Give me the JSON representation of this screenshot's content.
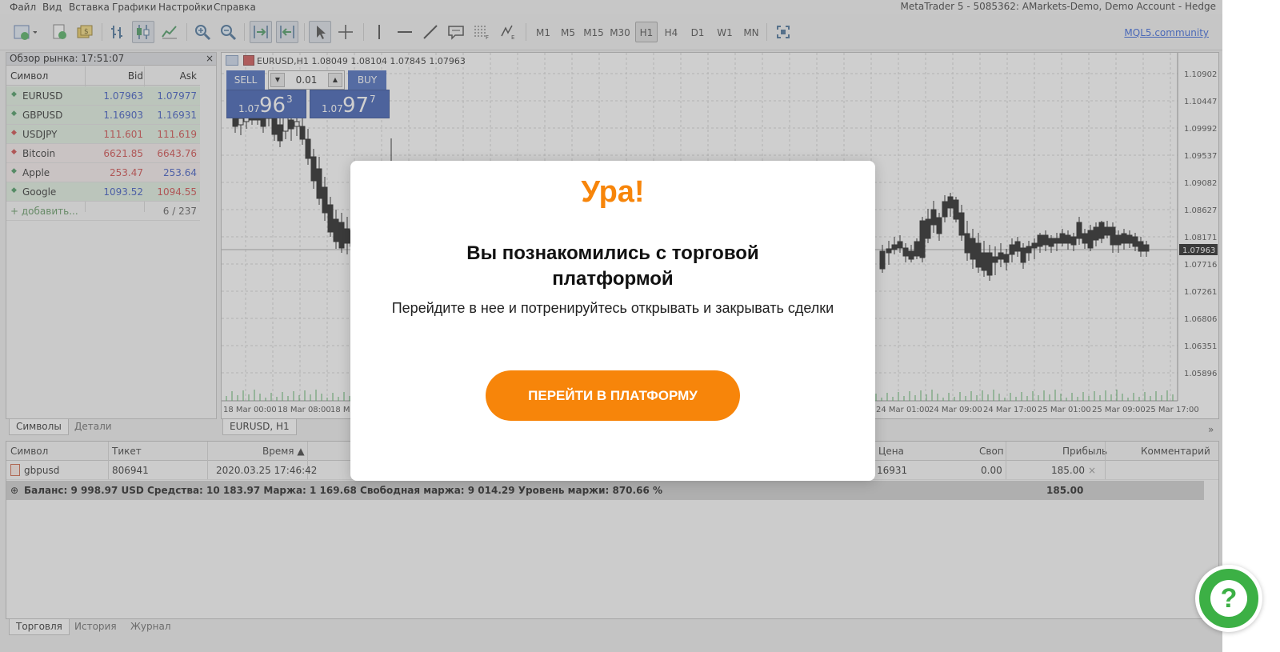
{
  "menu": {
    "items": [
      "Файл",
      "Вид",
      "Вставка",
      "Графики",
      "Настройки",
      "Справка"
    ],
    "window_title": "MetaTrader 5 - 5085362: AMarkets-Demo, Demo Account - Hedge"
  },
  "toolbar": {
    "timeframes": [
      "M1",
      "M5",
      "M15",
      "M30",
      "H1",
      "H4",
      "D1",
      "W1",
      "MN"
    ],
    "active_timeframe": "H1",
    "community_link": "MQL5.community"
  },
  "market_watch": {
    "title": "Обзор рынка: 17:51:07",
    "close_label": "×",
    "columns": {
      "symbol": "Символ",
      "bid": "Bid",
      "ask": "Ask"
    },
    "rows": [
      {
        "symbol": "EURUSD",
        "bid": "1.07963",
        "ask": "1.07977",
        "direction": "up"
      },
      {
        "symbol": "GBPUSD",
        "bid": "1.16903",
        "ask": "1.16931",
        "direction": "up"
      },
      {
        "symbol": "USDJPY",
        "bid": "111.601",
        "ask": "111.619",
        "direction": "down"
      },
      {
        "symbol": "Bitcoin",
        "bid": "6621.85",
        "ask": "6643.76",
        "direction": "down"
      },
      {
        "symbol": "Apple",
        "bid": "253.47",
        "ask": "253.64",
        "direction": "up"
      },
      {
        "symbol": "Google",
        "bid": "1093.52",
        "ask": "1094.55",
        "direction": "up"
      }
    ],
    "add_label": "+ добавить...",
    "count": "6 / 237",
    "tabs": [
      "Символы",
      "Детали"
    ]
  },
  "chart": {
    "info": "EURUSD,H1  1.08049 1.08104 1.07845 1.07963",
    "tab": "EURUSD, H1",
    "price_labels": [
      "1.10902",
      "1.10447",
      "1.09992",
      "1.09537",
      "1.09082",
      "1.08627",
      "1.08171",
      "1.07716",
      "1.07261",
      "1.06806",
      "1.06351",
      "1.05896"
    ],
    "current_price": "1.07963",
    "time_labels": [
      "18 Mar 00:00",
      "18 Mar 08:00",
      "18 Ma",
      "24 Mar 01:00",
      "24 Mar 09:00",
      "24 Mar 17:00",
      "25 Mar 01:00",
      "25 Mar 09:00",
      "25 Mar 17:00"
    ],
    "one_click": {
      "sell_label": "SELL",
      "buy_label": "BUY",
      "lot": "0.01",
      "sell_small": "1.07",
      "sell_big": "96",
      "sell_sup": "3",
      "buy_small": "1.07",
      "buy_big": "97",
      "buy_sup": "7"
    }
  },
  "terminal": {
    "columns": {
      "symbol": "Символ",
      "ticket": "Тикет",
      "time": "Время ▲",
      "price": "Цена",
      "swap": "Своп",
      "profit": "Прибыль",
      "comment": "Комментарий"
    },
    "row": {
      "symbol": "gbpusd",
      "ticket": "806941",
      "time": "2020.03.25 17:46:42",
      "price": "16931",
      "swap": "0.00",
      "profit": "185.00",
      "close": "×"
    },
    "balance_line": "Баланс: 9 998.97 USD  Средства: 10 183.97  Маржа: 1 169.68  Свободная маржа: 9 014.29  Уровень маржи: 870.66 %",
    "balance_profit": "185.00",
    "tabs": [
      "Торговля",
      "История",
      "Журнал"
    ],
    "expand": "»"
  },
  "modal": {
    "title": "Ура!",
    "heading_line1": "Вы познакомились с торговой",
    "heading_line2": "платформой",
    "description": "Перейдите в нее и потренируйтесь открывать и закрывать сделки",
    "cta": "ПЕРЕЙТИ В ПЛАТФОРМУ"
  },
  "chat": {
    "icon": "question-icon",
    "label": "?"
  },
  "colors": {
    "accent": "#f7850a",
    "chat": "#3cb045",
    "sell_buy_blue": "#2d55b3",
    "bid_up": "#1f3fb8",
    "bid_down": "#c93030"
  }
}
